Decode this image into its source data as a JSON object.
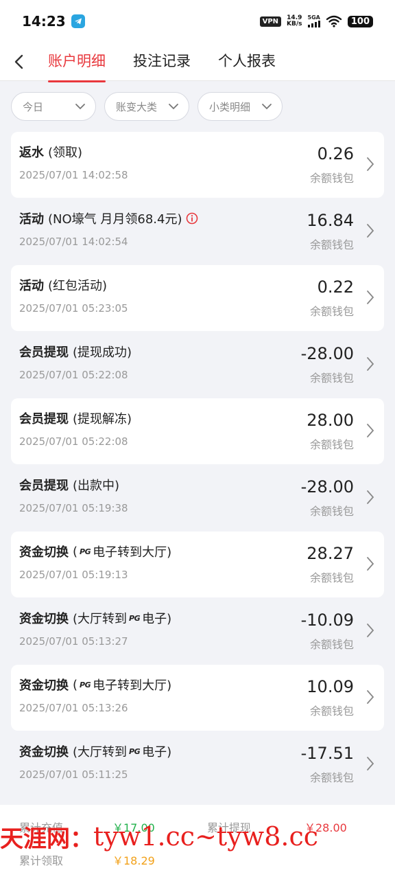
{
  "status_bar": {
    "time": "14:23",
    "vpn": "VPN",
    "net_speed_value": "14.9",
    "net_speed_unit": "KB/s",
    "network": "5GA",
    "battery": "100"
  },
  "nav": {
    "tabs": [
      {
        "label": "账户明细",
        "active": true
      },
      {
        "label": "投注记录",
        "active": false
      },
      {
        "label": "个人报表",
        "active": false
      }
    ]
  },
  "filters": [
    {
      "label": "今日"
    },
    {
      "label": "账变大类"
    },
    {
      "label": "小类明细"
    }
  ],
  "records": [
    {
      "type": "返水",
      "detail": "(领取)",
      "time": "2025/07/01 14:02:58",
      "amount": "0.26",
      "wallet": "余额钱包"
    },
    {
      "type": "活动",
      "detail": "(NO壕气 月月领68.4元)",
      "time": "2025/07/01 14:02:54",
      "amount": "16.84",
      "wallet": "余额钱包"
    },
    {
      "type": "活动",
      "detail": "(红包活动)",
      "time": "2025/07/01 05:23:05",
      "amount": "0.22",
      "wallet": "余额钱包"
    },
    {
      "type": "会员提现",
      "detail": "(提现成功)",
      "time": "2025/07/01 05:22:08",
      "amount": "-28.00",
      "wallet": "余额钱包"
    },
    {
      "type": "会员提现",
      "detail": "(提现解冻)",
      "time": "2025/07/01 05:22:08",
      "amount": "28.00",
      "wallet": "余额钱包"
    },
    {
      "type": "会员提现",
      "detail": "(出款中)",
      "time": "2025/07/01 05:19:38",
      "amount": "-28.00",
      "wallet": "余额钱包"
    },
    {
      "type": "资金切换",
      "detail_pre": "(",
      "pg": "PG",
      "detail_post": "电子转到大厅)",
      "time": "2025/07/01 05:19:13",
      "amount": "28.27",
      "wallet": "余额钱包"
    },
    {
      "type": "资金切换",
      "detail_pre": "(大厅转到",
      "pg": "PG",
      "detail_post": "电子)",
      "time": "2025/07/01 05:13:27",
      "amount": "-10.09",
      "wallet": "余额钱包"
    },
    {
      "type": "资金切换",
      "detail_pre": "(",
      "pg": "PG",
      "detail_post": "电子转到大厅)",
      "time": "2025/07/01 05:13:26",
      "amount": "10.09",
      "wallet": "余额钱包"
    },
    {
      "type": "资金切换",
      "detail_pre": "(大厅转到",
      "pg": "PG",
      "detail_post": "电子)",
      "time": "2025/07/01 05:11:25",
      "amount": "-17.51",
      "wallet": "余额钱包"
    }
  ],
  "summary": {
    "recharge_label": "累计充值",
    "recharge_value": "￥17.00",
    "withdraw_label": "累计提现",
    "withdraw_value": "￥28.00",
    "claim_label": "累计领取",
    "claim_value": "￥18.29"
  },
  "watermark": {
    "cn": "天涯网：",
    "url": "tyw1.cc~tyw8.cc"
  },
  "colors": {
    "accent": "#e8383d",
    "green": "#22b14c",
    "yellow": "#f2a11a",
    "watermark": "#e8201e"
  }
}
